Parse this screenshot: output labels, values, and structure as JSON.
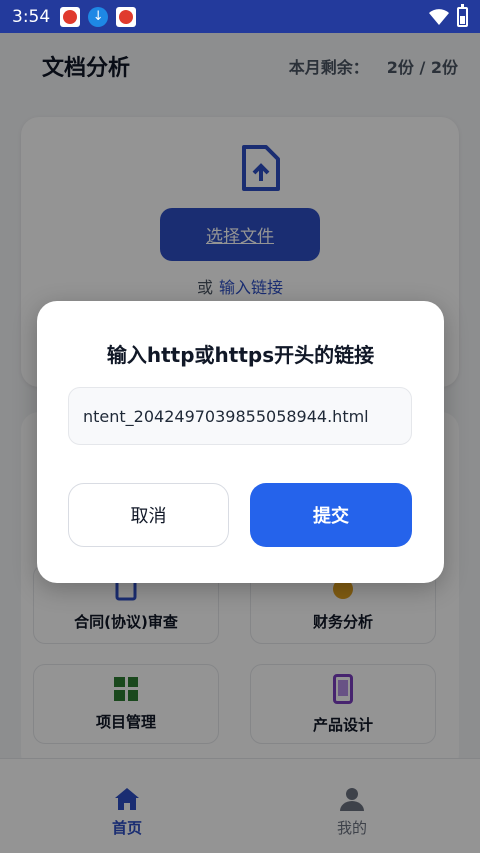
{
  "status_bar": {
    "time": "3:54"
  },
  "header": {
    "title": "文档分析",
    "quota_label": "本月剩余：",
    "quota_value": "2份 / 2份"
  },
  "upload": {
    "select_button": "选择文件",
    "or_text": "或",
    "link_text": "输入链接"
  },
  "tools": {
    "tiles": [
      {
        "label": "合同(协议)审查",
        "icon": "contract-icon"
      },
      {
        "label": "财务分析",
        "icon": "finance-icon"
      },
      {
        "label": "项目管理",
        "icon": "dashboard-icon"
      },
      {
        "label": "产品设计",
        "icon": "phone-icon"
      }
    ]
  },
  "dialog": {
    "title": "输入http或https开头的链接",
    "input_value": "ntent_2042497039855058944.html",
    "cancel_label": "取消",
    "submit_label": "提交"
  },
  "bottom_nav": {
    "home_label": "首页",
    "me_label": "我的"
  },
  "colors": {
    "primary": "#2d4fc4",
    "submit": "#2563eb",
    "status_bar": "#233a9c"
  }
}
